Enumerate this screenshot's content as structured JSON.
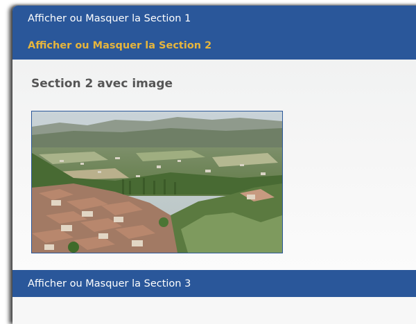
{
  "sections": [
    {
      "label": "Afficher ou Masquer la Section 1",
      "active": false
    },
    {
      "label": "Afficher ou Masquer la Section 2",
      "active": true
    },
    {
      "label": "Afficher ou Masquer la Section 3",
      "active": false
    }
  ],
  "section2": {
    "heading": "Section 2 avec image",
    "image_subject": "hillside village landscape photo"
  },
  "colors": {
    "header_bg": "#2a579a",
    "header_text": "#ffffff",
    "active_text": "#e6b53c",
    "heading_text": "#555555"
  }
}
